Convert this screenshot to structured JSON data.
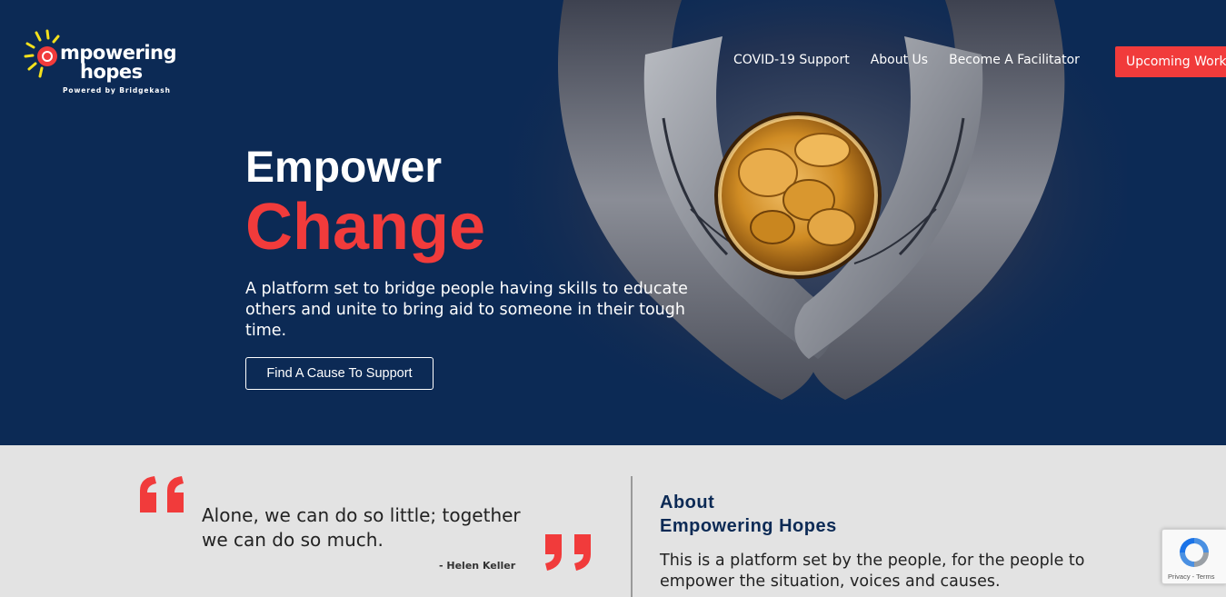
{
  "header": {
    "logo": {
      "line1": "mpowering",
      "line2": "hopes",
      "tagline": "Powered by Bridgekash"
    },
    "nav": [
      {
        "label": "COVID-19 Support"
      },
      {
        "label": "About Us"
      },
      {
        "label": "Become A Facilitator"
      }
    ],
    "cta_label": "Upcoming Work"
  },
  "hero": {
    "title_line1": "Empower",
    "title_line2": "Change",
    "description": "A platform set to bridge people having skills to educate others and unite to bring aid to someone in their tough time.",
    "button_label": "Find A Cause To Support"
  },
  "quote": {
    "text": "Alone, we can do so little; together we can do so much.",
    "author": "- Helen Keller"
  },
  "about": {
    "title_line1": "About",
    "title_line2": "Empowering Hopes",
    "text": "This is a platform set by the people, for the people to empower the situation, voices and causes."
  },
  "recaptcha": {
    "terms": "Privacy - Terms"
  },
  "colors": {
    "navy": "#0c2a55",
    "accent": "#f13b3b",
    "section_bg": "#e3e3e3"
  }
}
